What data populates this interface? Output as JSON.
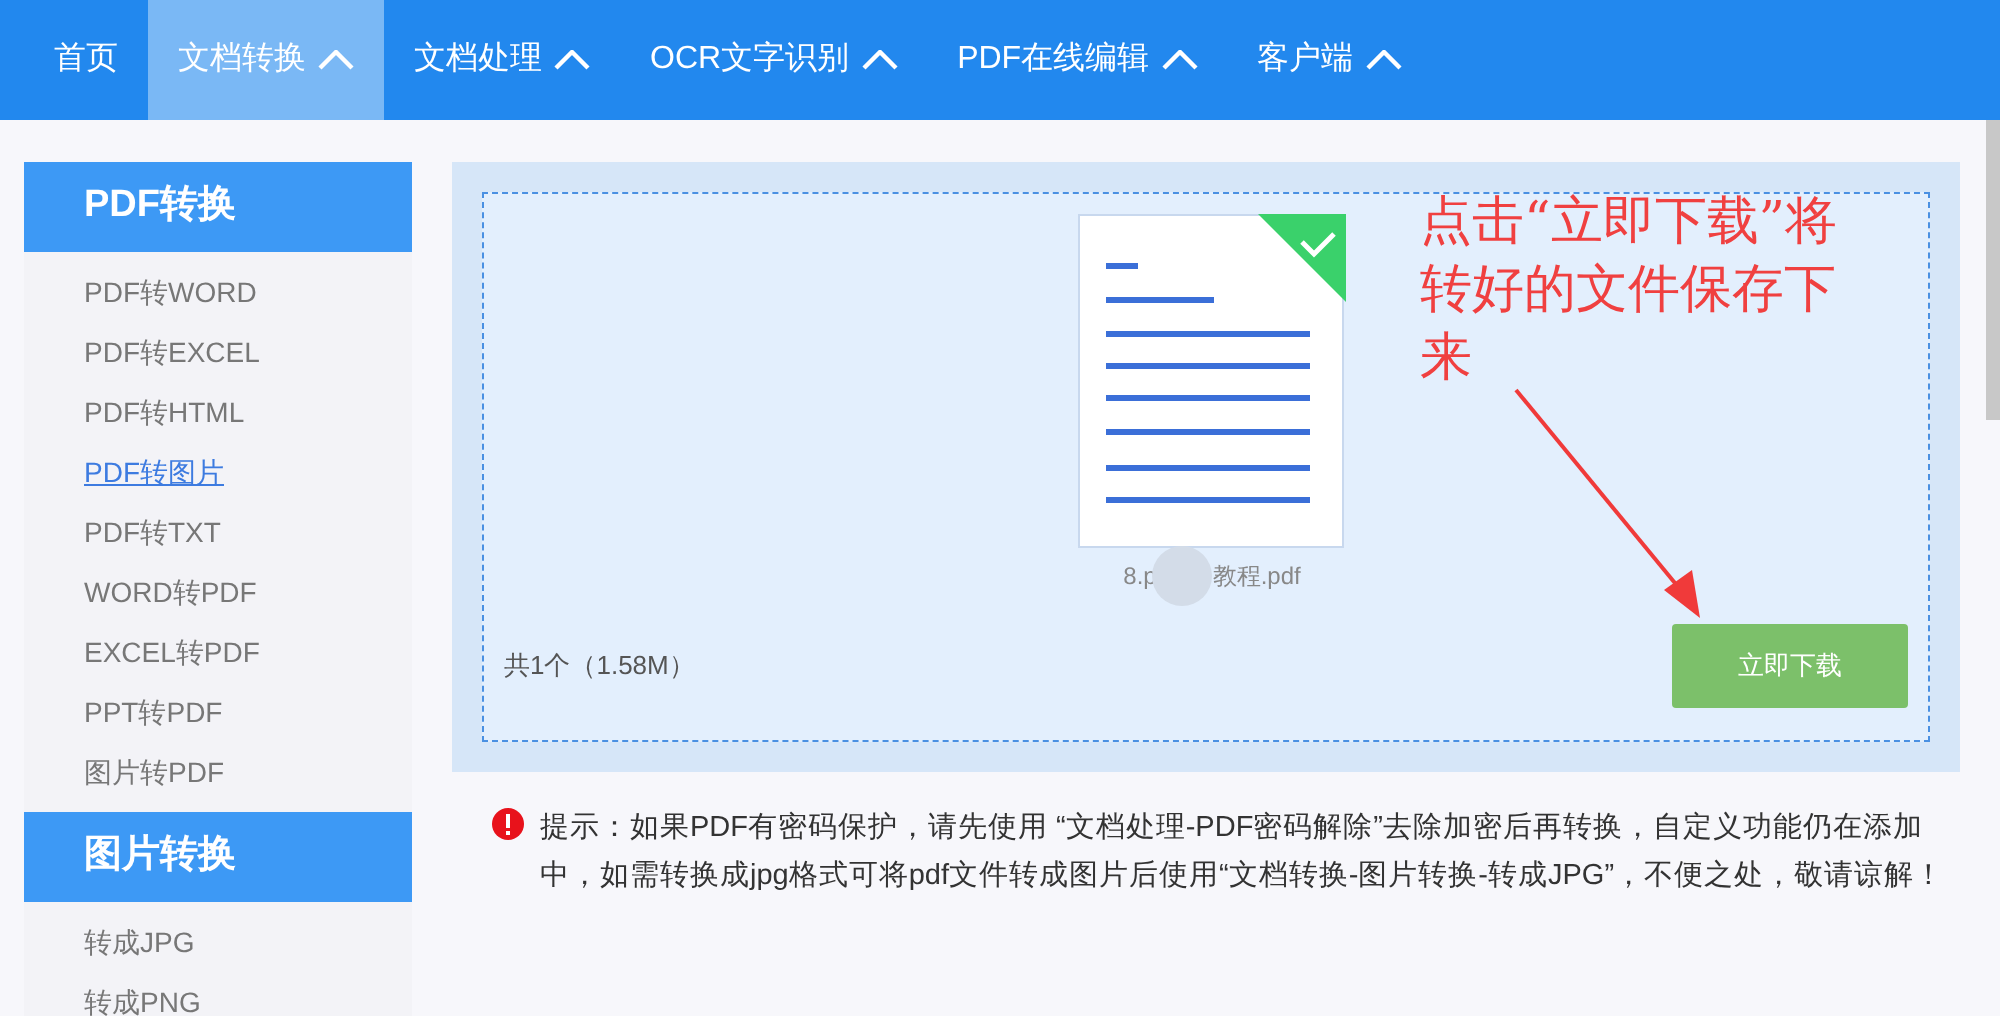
{
  "nav": [
    {
      "label": "首页",
      "selected": false,
      "caret": false
    },
    {
      "label": "文档转换",
      "selected": true,
      "caret": true
    },
    {
      "label": "文档处理",
      "selected": false,
      "caret": true
    },
    {
      "label": "OCR文字识别",
      "selected": false,
      "caret": true
    },
    {
      "label": "PDF在线编辑",
      "selected": false,
      "caret": true
    },
    {
      "label": "客户端",
      "selected": false,
      "caret": true
    }
  ],
  "sidebar": [
    {
      "title": "PDF转换",
      "items": [
        {
          "label": "PDF转WORD",
          "selected": false
        },
        {
          "label": "PDF转EXCEL",
          "selected": false
        },
        {
          "label": "PDF转HTML",
          "selected": false
        },
        {
          "label": "PDF转图片",
          "selected": true
        },
        {
          "label": "PDF转TXT",
          "selected": false
        },
        {
          "label": "WORD转PDF",
          "selected": false
        },
        {
          "label": "EXCEL转PDF",
          "selected": false
        },
        {
          "label": "PPT转PDF",
          "selected": false
        },
        {
          "label": "图片转PDF",
          "selected": false
        }
      ]
    },
    {
      "title": "图片转换",
      "items": [
        {
          "label": "转成JPG",
          "selected": false
        },
        {
          "label": "转成PNG",
          "selected": false
        }
      ]
    }
  ],
  "file": {
    "name_start": "8.p",
    "name_end": "教程.pdf",
    "converted": true
  },
  "summary": "共1个（1.58M）",
  "download_button": "立即下载",
  "annotation": "点击“立即下载”将转好的文件保存下来",
  "notice": "提示：如果PDF有密码保护，请先使用 “文档处理-PDF密码解除”去除加密后再转换，自定义功能仍在添加中，如需转换成jpg格式可将pdf文件转成图片后使用“文档转换-图片转换-转成JPG”，不便之处，敬请谅解！"
}
